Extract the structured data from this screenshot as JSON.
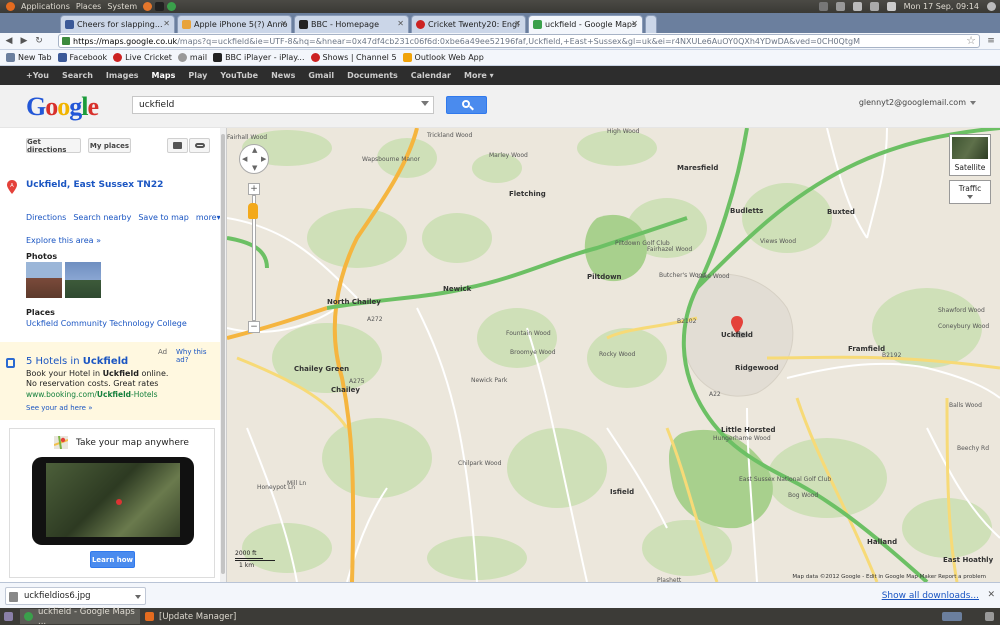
{
  "top_panel": {
    "menus": [
      "Applications",
      "Places",
      "System"
    ],
    "clock": "Mon 17 Sep,  09:14"
  },
  "tabs": [
    {
      "label": "Cheers for slapping...",
      "color": "#3b5998"
    },
    {
      "label": "Apple iPhone 5(?) Anno",
      "color": "#e8a33b"
    },
    {
      "label": "BBC - Homepage",
      "color": "#222222"
    },
    {
      "label": "Cricket Twenty20: Engl",
      "color": "#cc2222"
    },
    {
      "label": "uckfield - Google Maps",
      "color": "#3aa04b"
    }
  ],
  "address": {
    "host": "https://maps.google.co.uk",
    "rest": "/maps?q=uckfield&ie=UTF-8&hq=&hnear=0x47df4cb231c06f6d:0xbe6a49ee52196faf,Uckfield,+East+Sussex&gl=uk&ei=r4NXULe6AuOY0QXh4YDwDA&ved=0CH0QtgM"
  },
  "bookmarks": [
    {
      "label": "New Tab",
      "color": "#6b7f9e"
    },
    {
      "label": "Facebook",
      "color": "#3b5998"
    },
    {
      "label": "Live Cricket",
      "color": "#cc2222"
    },
    {
      "label": "mail",
      "color": "#999999"
    },
    {
      "label": "BBC iPlayer - iPlay...",
      "color": "#222222"
    },
    {
      "label": "Shows | Channel 5",
      "color": "#cc2222"
    },
    {
      "label": "Outlook Web App",
      "color": "#f0a30a"
    }
  ],
  "gbar": {
    "items": [
      "+You",
      "Search",
      "Images",
      "Maps",
      "Play",
      "YouTube",
      "News",
      "Gmail",
      "Documents",
      "Calendar",
      "More ▾"
    ],
    "active": "Maps"
  },
  "header": {
    "logo_letters": [
      "G",
      "o",
      "o",
      "g",
      "l",
      "e"
    ],
    "search_value": "uckfield",
    "account": "glennyt2@googlemail.com"
  },
  "left": {
    "get_directions": "Get directions",
    "my_places": "My places",
    "pin_label": "A",
    "place_title": "Uckfield, East Sussex TN22",
    "actions": [
      "Directions",
      "Search nearby",
      "Save to map",
      "more▾"
    ],
    "explore": "Explore this area »",
    "photos_heading": "Photos",
    "places_heading": "Places",
    "places_link": "Uckfield Community Technology College",
    "ad": {
      "tag": "Ad",
      "why": "Why this ad?",
      "title_prefix": "5 Hotels in ",
      "title_bold": "Uckfield",
      "line1_prefix": "Book your Hotel in ",
      "line1_bold": "Uckfield",
      "line1_suffix": " online.",
      "line2": "No reservation costs. Great rates",
      "url_prefix": "www.booking.com/",
      "url_bold": "Uckfield",
      "url_suffix": "-Hotels",
      "see_ad": "See your ad here »"
    },
    "promo": {
      "title": "Take your map anywhere",
      "button": "Learn how"
    }
  },
  "map": {
    "labels": [
      {
        "text": "Fairhall Wood"
      },
      {
        "text": "Trickland Wood"
      },
      {
        "text": "High Wood"
      },
      {
        "text": "Marley Wood"
      },
      {
        "text": "Wapsbourne Manor"
      },
      {
        "text": "Fletching"
      },
      {
        "text": "Maresfield"
      },
      {
        "text": "Budletts"
      },
      {
        "text": "Buxted"
      },
      {
        "text": "Piltdown Golf Club"
      },
      {
        "text": "Fairhazel Wood"
      },
      {
        "text": "Piltdown"
      },
      {
        "text": "Newick"
      },
      {
        "text": "North Chailey"
      },
      {
        "text": "Views Wood"
      },
      {
        "text": "Butcher's Wood"
      },
      {
        "text": "Lake Wood"
      },
      {
        "text": "Uckfield"
      },
      {
        "text": "Ridgewood"
      },
      {
        "text": "Framfield"
      },
      {
        "text": "Chailey Green"
      },
      {
        "text": "Chailey"
      },
      {
        "text": "Newick Park"
      },
      {
        "text": "Fountain Wood"
      },
      {
        "text": "Broomye Wood"
      },
      {
        "text": "Rocky Wood"
      },
      {
        "text": "Little Horsted"
      },
      {
        "text": "East Sussex National Golf Club"
      },
      {
        "text": "Hungerhame Wood"
      },
      {
        "text": "Isfield"
      },
      {
        "text": "Plashett"
      },
      {
        "text": "Halland"
      },
      {
        "text": "Chilpark Wood"
      },
      {
        "text": "Bog Wood"
      },
      {
        "text": "Shawford Wood"
      },
      {
        "text": "Coneybury Wood"
      },
      {
        "text": "Beechy Rd"
      },
      {
        "text": "Balls Wood"
      },
      {
        "text": "East Hoathly"
      },
      {
        "text": "Honeypot Ln"
      },
      {
        "text": "Mill Ln"
      },
      {
        "text": "A272"
      },
      {
        "text": "A275"
      },
      {
        "text": "A22"
      },
      {
        "text": "B2102"
      },
      {
        "text": "B2192"
      }
    ],
    "satellite": "Satellite",
    "traffic": "Traffic",
    "scale_ft": "2000 ft",
    "scale_km": "1 km",
    "mapdata": "Map data ©2012 Google -  Edit in Google Map Maker  Report a problem"
  },
  "download": {
    "file": "uckfieldios6.jpg",
    "show_all": "Show all downloads..."
  },
  "taskbar": [
    {
      "label": "uckfield - Google Maps ...",
      "color": "#3aa04b"
    },
    {
      "label": "[Update Manager]",
      "color": "#e46b1f"
    }
  ]
}
